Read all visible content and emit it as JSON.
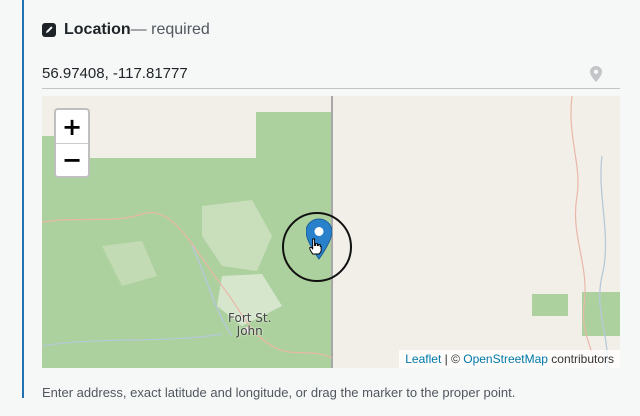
{
  "field": {
    "title": "Location",
    "required_suffix": " — required",
    "edit_icon": "edit-icon"
  },
  "coords": {
    "value": "56.97408, -117.81777",
    "pin_icon": "location-pin-icon"
  },
  "map": {
    "zoom_in_label": "+",
    "zoom_out_label": "−",
    "town_label_line1": "Fort St.",
    "town_label_line2": "John",
    "attribution": {
      "leaflet": "Leaflet",
      "separator": " | © ",
      "osm": "OpenStreetMap",
      "contributors": " contributors"
    },
    "marker_icon": "map-marker-icon",
    "cursor_icon": "hand-cursor-icon"
  },
  "help": {
    "text": "Enter address, exact latitude and longitude, or drag the marker to the proper point."
  },
  "colors": {
    "accent": "#2271b1",
    "forest": "#add19e",
    "land": "#f2efe9",
    "marker": "#2a81cb"
  }
}
